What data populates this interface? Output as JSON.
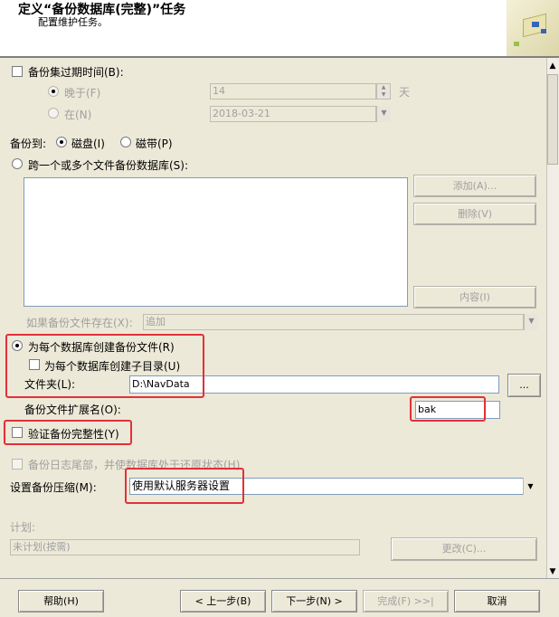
{
  "header": {
    "title": "定义“备份数据库(完整)”任务",
    "subtitle": "配置维护任务。"
  },
  "backup_set_expiry": {
    "label": "备份集过期时间(B):",
    "checked": false
  },
  "expire_after": {
    "label": "晚于(F)",
    "value": "14",
    "unit": "天"
  },
  "expire_on": {
    "label": "在(N)",
    "value": "2018-03-21"
  },
  "backup_to": {
    "label": "备份到:",
    "disk_label": "磁盘(I)",
    "tape_label": "磁带(P)",
    "selected": "disk"
  },
  "across_files": {
    "label": "跨一个或多个文件备份数据库(S):"
  },
  "file_buttons": {
    "add": "添加(A)...",
    "remove": "删除(V)",
    "contents": "内容(I)"
  },
  "if_exists": {
    "label": "如果备份文件存在(X):",
    "value": "追加"
  },
  "per_db": {
    "label": "为每个数据库创建备份文件(R)",
    "subdir_label": "为每个数据库创建子目录(U)"
  },
  "folder": {
    "label": "文件夹(L):",
    "value": "D:\\NavData",
    "browse": "..."
  },
  "extension": {
    "label": "备份文件扩展名(O):",
    "value": "bak"
  },
  "verify": {
    "label": "验证备份完整性(Y)"
  },
  "tail_log": {
    "label": "备份日志尾部，并使数据库处于还原状态(H)"
  },
  "compression": {
    "label": "设置备份压缩(M):",
    "value": "使用默认服务器设置"
  },
  "schedule": {
    "label": "计划:",
    "value": "未计划(按需)",
    "change_button": "更改(C)..."
  },
  "footer": {
    "help": "帮助(H)",
    "back": "< 上一步(B)",
    "next": "下一步(N) >",
    "finish": "完成(F) >>|",
    "cancel": "取消"
  },
  "colors": {
    "highlight": "#e2303a",
    "content_bg": "#ece9d8"
  }
}
